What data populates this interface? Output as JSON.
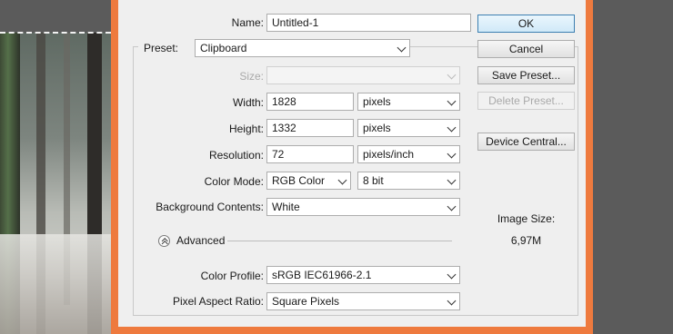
{
  "dialog": {
    "name": {
      "label": "Name:",
      "value": "Untitled-1"
    },
    "preset": {
      "label": "Preset:",
      "value": "Clipboard"
    },
    "size": {
      "label": "Size:",
      "value": ""
    },
    "width": {
      "label": "Width:",
      "value": "1828",
      "unit": "pixels"
    },
    "height": {
      "label": "Height:",
      "value": "1332",
      "unit": "pixels"
    },
    "resolution": {
      "label": "Resolution:",
      "value": "72",
      "unit": "pixels/inch"
    },
    "color_mode": {
      "label": "Color Mode:",
      "value": "RGB Color",
      "depth": "8 bit"
    },
    "background": {
      "label": "Background Contents:",
      "value": "White"
    },
    "advanced": {
      "label": "Advanced"
    },
    "color_profile": {
      "label": "Color Profile:",
      "value": "sRGB IEC61966-2.1"
    },
    "pixel_aspect": {
      "label": "Pixel Aspect Ratio:",
      "value": "Square Pixels"
    }
  },
  "buttons": {
    "ok": "OK",
    "cancel": "Cancel",
    "save_preset": "Save Preset...",
    "delete_preset": "Delete Preset...",
    "device_central": "Device Central..."
  },
  "image_size": {
    "label": "Image Size:",
    "value": "6,97M"
  },
  "colors": {
    "dialog_frame": "#ee7a3e",
    "default_button_border": "#3c7fb1"
  }
}
